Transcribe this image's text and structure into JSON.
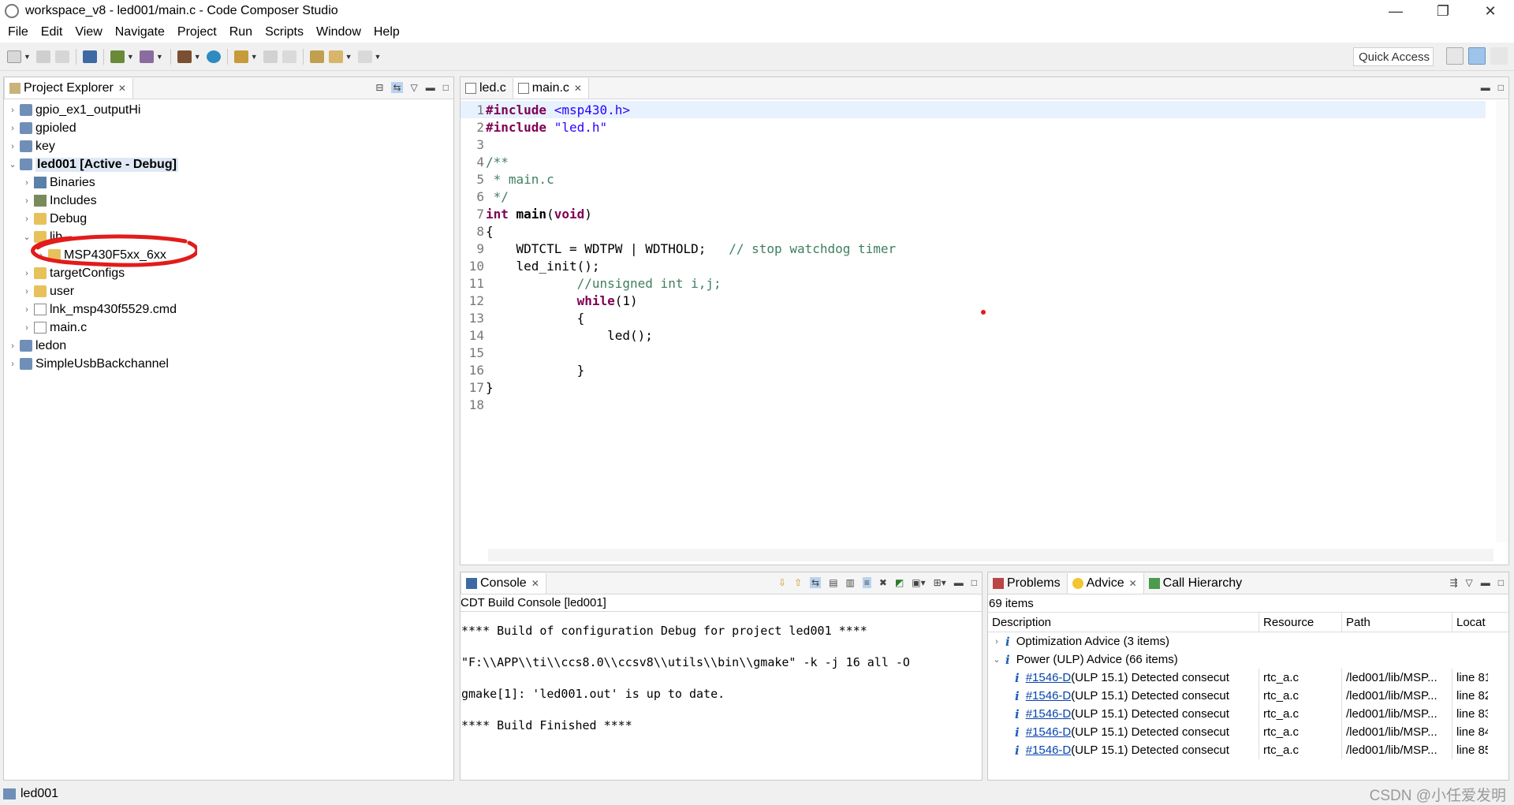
{
  "window": {
    "title": "workspace_v8 - led001/main.c - Code Composer Studio",
    "min": "—",
    "max": "❐",
    "close": "✕"
  },
  "menu": [
    "File",
    "Edit",
    "View",
    "Navigate",
    "Project",
    "Run",
    "Scripts",
    "Window",
    "Help"
  ],
  "toolbar": {
    "quick_access": "Quick Access"
  },
  "explorer": {
    "tab": "Project Explorer",
    "tree": [
      {
        "label": "gpio_ex1_outputHi",
        "depth": 0,
        "icon": "project-icon",
        "expanded": false
      },
      {
        "label": "gpioled",
        "depth": 0,
        "icon": "project-icon",
        "expanded": false
      },
      {
        "label": "key",
        "depth": 0,
        "icon": "project-icon",
        "expanded": false
      },
      {
        "label": "led001  [Active - Debug]",
        "depth": 0,
        "icon": "project-icon",
        "expanded": true,
        "selected": true
      },
      {
        "label": "Binaries",
        "depth": 1,
        "icon": "binaries-icon",
        "expanded": false
      },
      {
        "label": "Includes",
        "depth": 1,
        "icon": "includes-icon",
        "expanded": false
      },
      {
        "label": "Debug",
        "depth": 1,
        "icon": "folder-icon",
        "expanded": false
      },
      {
        "label": "lib",
        "depth": 1,
        "icon": "folder-icon",
        "expanded": true
      },
      {
        "label": "MSP430F5xx_6xx",
        "depth": 2,
        "icon": "folder-icon",
        "expanded": false
      },
      {
        "label": "targetConfigs",
        "depth": 1,
        "icon": "folder-icon",
        "expanded": false
      },
      {
        "label": "user",
        "depth": 1,
        "icon": "folder-icon",
        "expanded": false
      },
      {
        "label": "lnk_msp430f5529.cmd",
        "depth": 1,
        "icon": "file-icon",
        "expanded": false
      },
      {
        "label": "main.c",
        "depth": 1,
        "icon": "c-file-icon",
        "expanded": false
      },
      {
        "label": "ledon",
        "depth": 0,
        "icon": "project-icon",
        "expanded": false
      },
      {
        "label": "SimpleUsbBackchannel",
        "depth": 0,
        "icon": "project-icon",
        "expanded": false
      }
    ]
  },
  "editor": {
    "tabs": [
      {
        "label": "led.c",
        "active": false
      },
      {
        "label": "main.c",
        "active": true
      }
    ],
    "lines": [
      {
        "n": "1",
        "segs": [
          {
            "t": "#include ",
            "c": "kw"
          },
          {
            "t": "<msp430.h>",
            "c": "str"
          }
        ]
      },
      {
        "n": "2",
        "segs": [
          {
            "t": "#include ",
            "c": "kw"
          },
          {
            "t": "\"led.h\"",
            "c": "str"
          }
        ]
      },
      {
        "n": "3",
        "segs": []
      },
      {
        "n": "4",
        "segs": [
          {
            "t": "/**",
            "c": "cmt"
          }
        ]
      },
      {
        "n": "5",
        "segs": [
          {
            "t": " * main.c",
            "c": "cmt"
          }
        ]
      },
      {
        "n": "6",
        "segs": [
          {
            "t": " */",
            "c": "cmt"
          }
        ]
      },
      {
        "n": "7",
        "segs": [
          {
            "t": "int ",
            "c": "kw"
          },
          {
            "t": "main",
            "c": "b"
          },
          {
            "t": "(",
            "c": ""
          },
          {
            "t": "void",
            "c": "kw"
          },
          {
            "t": ")",
            "c": ""
          }
        ]
      },
      {
        "n": "8",
        "segs": [
          {
            "t": "{",
            "c": ""
          }
        ]
      },
      {
        "n": "9",
        "segs": [
          {
            "t": "    WDTCTL = WDTPW | WDTHOLD;   ",
            "c": ""
          },
          {
            "t": "// stop watchdog timer",
            "c": "cmt"
          }
        ]
      },
      {
        "n": "10",
        "segs": [
          {
            "t": "    led_init();",
            "c": ""
          }
        ]
      },
      {
        "n": "11",
        "segs": [
          {
            "t": "            //unsigned int i,j;",
            "c": "cmt"
          }
        ]
      },
      {
        "n": "12",
        "segs": [
          {
            "t": "            ",
            "c": ""
          },
          {
            "t": "while",
            "c": "kw"
          },
          {
            "t": "(1)",
            "c": ""
          }
        ]
      },
      {
        "n": "13",
        "segs": [
          {
            "t": "            {",
            "c": ""
          }
        ]
      },
      {
        "n": "14",
        "segs": [
          {
            "t": "                led();",
            "c": ""
          }
        ]
      },
      {
        "n": "15",
        "segs": []
      },
      {
        "n": "16",
        "segs": [
          {
            "t": "            }",
            "c": ""
          }
        ]
      },
      {
        "n": "17",
        "segs": [
          {
            "t": "}",
            "c": ""
          }
        ]
      },
      {
        "n": "18",
        "segs": []
      }
    ]
  },
  "console": {
    "tab": "Console",
    "title": "CDT Build Console [led001]",
    "lines": [
      "**** Build of configuration Debug for project led001 ****",
      "\"F:\\\\APP\\\\ti\\\\ccs8.0\\\\ccsv8\\\\utils\\\\bin\\\\gmake\" -k -j 16 all -O",
      "gmake[1]: 'led001.out' is up to date.",
      "**** Build Finished ****"
    ]
  },
  "problems": {
    "tabs": [
      "Problems",
      "Advice",
      "Call Hierarchy"
    ],
    "count": "69 items",
    "columns": [
      "Description",
      "Resource",
      "Path",
      "Locat"
    ],
    "groups": [
      {
        "label": "Optimization Advice (3 items)",
        "expanded": false
      },
      {
        "label": "Power (ULP) Advice (66 items)",
        "expanded": true
      }
    ],
    "rows": [
      {
        "id": "#1546-D",
        "desc": " (ULP 15.1) Detected consecut",
        "resource": "rtc_a.c",
        "path": "/led001/lib/MSP...",
        "loc": "line 81"
      },
      {
        "id": "#1546-D",
        "desc": " (ULP 15.1) Detected consecut",
        "resource": "rtc_a.c",
        "path": "/led001/lib/MSP...",
        "loc": "line 82"
      },
      {
        "id": "#1546-D",
        "desc": " (ULP 15.1) Detected consecut",
        "resource": "rtc_a.c",
        "path": "/led001/lib/MSP...",
        "loc": "line 83"
      },
      {
        "id": "#1546-D",
        "desc": " (ULP 15.1) Detected consecut",
        "resource": "rtc_a.c",
        "path": "/led001/lib/MSP...",
        "loc": "line 84"
      },
      {
        "id": "#1546-D",
        "desc": " (ULP 15.1) Detected consecut",
        "resource": "rtc_a.c",
        "path": "/led001/lib/MSP...",
        "loc": "line 85"
      }
    ]
  },
  "status": {
    "text": "led001"
  },
  "watermark": "CSDN @小任爱发明",
  "colors": {
    "annotation_red": "#e21b1b",
    "selection": "#dfe9f5",
    "keyword": "#7f0055",
    "string": "#2a00ff",
    "comment": "#3f7f5f"
  }
}
